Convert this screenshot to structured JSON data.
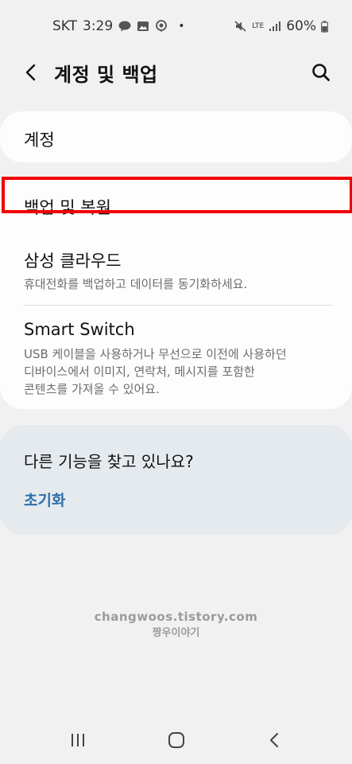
{
  "status_bar": {
    "carrier": "SKT",
    "time": "3:29",
    "dot": "•",
    "network": "LTE",
    "battery": "60%",
    "left_icons": [
      "talk-icon",
      "gallery-icon",
      "location-icon"
    ],
    "right_icons": [
      "mute-icon",
      "lte-icon",
      "signal-icon",
      "battery-icon"
    ]
  },
  "header": {
    "title": "계정 및 백업",
    "icons": [
      "back-arrow-icon",
      "search-icon"
    ]
  },
  "items": {
    "account": {
      "title": "계정"
    },
    "backup": {
      "title": "백업 및 복원"
    },
    "cloud": {
      "title": "삼성 클라우드",
      "subtitle": "휴대전화를 백업하고 데이터를 동기화하세요."
    },
    "smart_switch": {
      "title": "Smart Switch",
      "subtitle_line1": "USB 케이블을 사용하거나 무선으로 이전에 사용하던",
      "subtitle_line2": "디바이스에서 이미지, 연락처, 메시지를 포함한",
      "subtitle_line3": "콘텐츠를 가져올 수 있어요."
    }
  },
  "suggestion": {
    "title": "다른 기능을 찾고 있나요?",
    "link": "초기화"
  },
  "watermark": {
    "line1": "changwoos.tistory.com",
    "line2": "짱우이야기"
  },
  "nav": {
    "icons": [
      "recents-icon",
      "home-icon",
      "back-icon"
    ]
  },
  "colors": {
    "background": "#f1f1f1",
    "card": "#fdfdfd",
    "suggest_card": "#e5eaef",
    "link": "#2e6eaa",
    "highlight": "#f00000"
  }
}
